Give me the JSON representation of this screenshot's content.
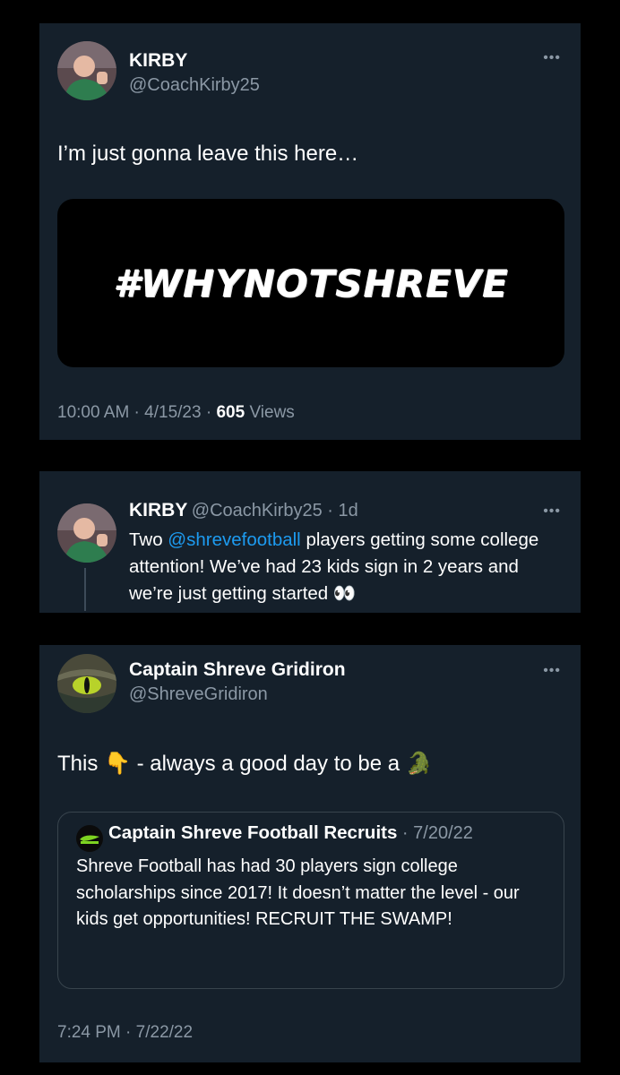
{
  "tweet1": {
    "name": "KIRBY",
    "handle": "@CoachKirby25",
    "text": "I’m just gonna leave this here…",
    "media_text": "#WHYNOTSHREVE",
    "time": "10:00 AM",
    "date": "4/15/23",
    "views_count": "605",
    "views_label": "Views",
    "more_icon": "more-horizontal-icon"
  },
  "tweet2": {
    "name": "KIRBY",
    "handle": "@CoachKirby25",
    "age": "1d",
    "text_start": "Two ",
    "mention": "@shrevefootball",
    "text_end": " players getting some college attention! We’ve had 23 kids sign in 2 years and we’re just getting started",
    "emoji": "👀",
    "more_icon": "more-horizontal-icon"
  },
  "tweet3": {
    "name": "Captain Shreve Gridiron",
    "handle": "@ShreveGridiron",
    "text_start": "This",
    "emoji_point": "👇",
    "text_mid": " - always a good day to be a",
    "emoji_gator": "🐊",
    "quote": {
      "name": "Captain Shreve Football Recruits",
      "date": "7/20/22",
      "text": "Shreve Football has had 30 players sign college scholarships since 2017! It doesn’t matter the level - our kids get opportunities! RECRUIT THE SWAMP!"
    },
    "time": "7:24 PM",
    "date": "7/22/22",
    "more_icon": "more-horizontal-icon"
  },
  "colors": {
    "background": "#000000",
    "card": "#15202b",
    "primary_text": "#ffffff",
    "secondary_text": "#8b98a5",
    "link": "#1d9bf0",
    "border": "#38444d"
  }
}
